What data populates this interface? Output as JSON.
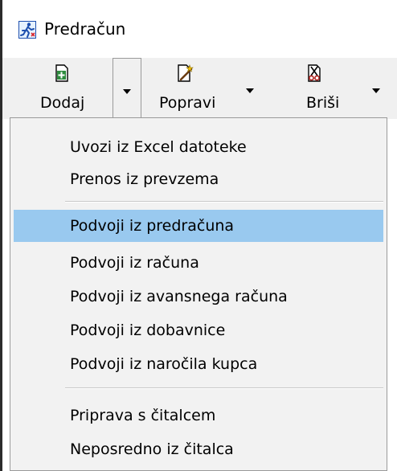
{
  "window": {
    "title": "Predračun",
    "icon": "running-figure-icon"
  },
  "toolbar": {
    "add_label": "Dodaj",
    "add_icon": "add-document-icon",
    "edit_label": "Popravi",
    "edit_icon": "edit-wand-icon",
    "delete_label": "Briši",
    "delete_icon": "delete-scissors-icon"
  },
  "menu": {
    "groups": [
      [
        "Uvozi iz Excel datoteke",
        "Prenos iz prevzema"
      ],
      [
        "Podvoji iz predračuna",
        "Podvoji iz računa",
        "Podvoji iz avansnega računa",
        "Podvoji iz dobavnice",
        "Podvoji iz naročila kupca"
      ],
      [
        "Priprava s čitalcem",
        "Neposredno iz čitalca"
      ]
    ],
    "highlighted": "Podvoji iz predračuna"
  },
  "colors": {
    "highlight": "#99c9ef",
    "menu_background": "#f2f2f2",
    "toolbar_background": "#f0f0f0"
  }
}
